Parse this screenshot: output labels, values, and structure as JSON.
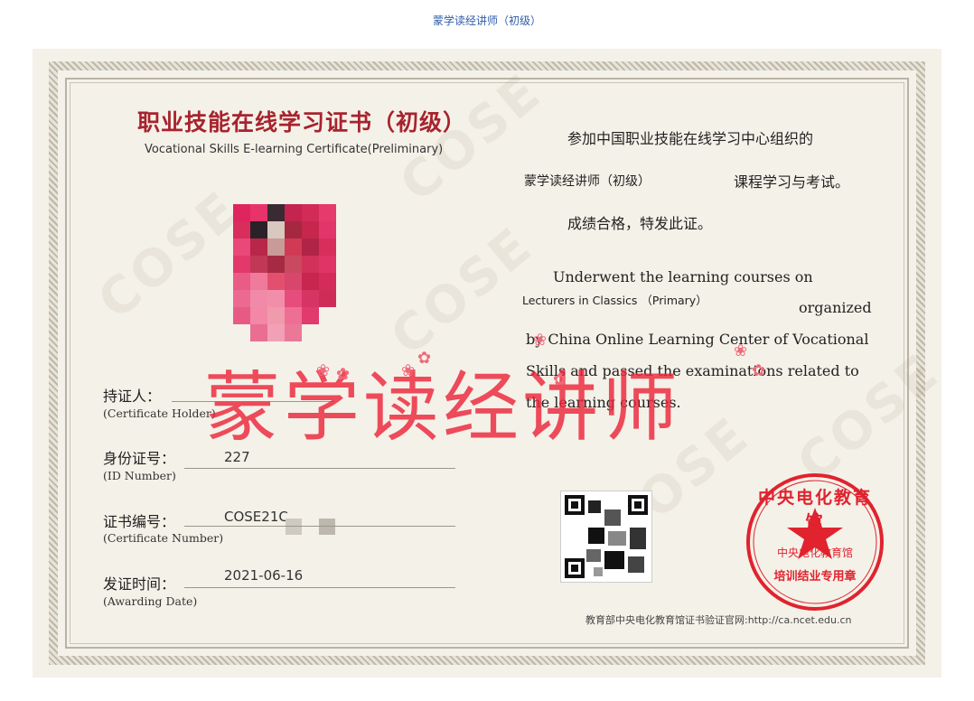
{
  "header": {
    "title": "蒙学读经讲师（初级）"
  },
  "certificate": {
    "title_cn": "职业技能在线学习证书（初级）",
    "title_en": "Vocational Skills E-learning Certificate(Preliminary)",
    "body_cn_line1": "参加中国职业技能在线学习中心组织的",
    "course_cn": "蒙学读经讲师（初级）",
    "body_cn_line2_suffix": "课程学习与考试。",
    "body_cn_line3": "成绩合格，特发此证。",
    "body_en_line1": "Underwent the learning courses on",
    "course_en": "Lecturers in Classics （Primary）",
    "body_en_organized": "organized",
    "body_en_line3": "by China Online Learning Center of Vocational",
    "body_en_line4": "Skills and passed the examinations related to",
    "body_en_line5": "the learning courses.",
    "fields": [
      {
        "label_cn": "持证人：",
        "label_en": "(Certificate Holder)",
        "value": ""
      },
      {
        "label_cn": "身份证号：",
        "label_en": "(ID Number)",
        "value": "227"
      },
      {
        "label_cn": "证书编号：",
        "label_en": "(Certificate Number)",
        "value": "COSE21C"
      },
      {
        "label_cn": "发证时间：",
        "label_en": "(Awarding Date)",
        "value": "2021-06-16"
      }
    ],
    "overlay_text": "蒙学读经讲师",
    "watermark_text": "COSE",
    "seal": {
      "top_arc": "中央电化教育馆",
      "inner": "中央电化教育馆",
      "bottom": "培训结业专用章",
      "color": "#e0232f"
    },
    "footer": "教育部中央电化教育馆证书验证官网:http://ca.ncet.edu.cn"
  },
  "colors": {
    "title_red": "#a7232e",
    "paper": "#f4f1e8",
    "header_blue": "#2f5da8"
  }
}
